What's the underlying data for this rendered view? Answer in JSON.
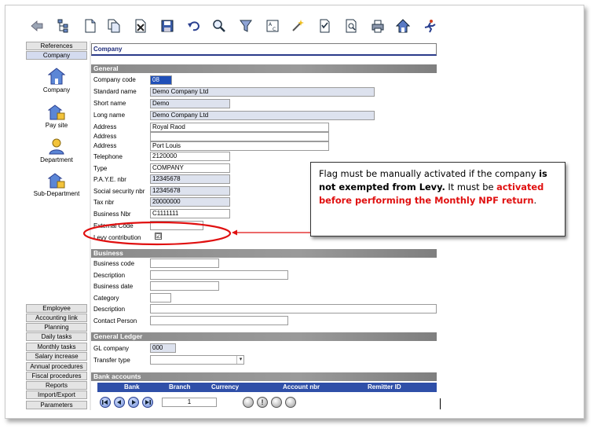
{
  "toolbar": {
    "icons": [
      "exit-icon",
      "tree-icon",
      "new-document-icon",
      "copy-document-icon",
      "delete-document-icon",
      "save-icon",
      "undo-icon",
      "search-icon",
      "filter-icon",
      "sort-icon",
      "wizard-icon",
      "checklist-icon",
      "report-preview-icon",
      "print-icon",
      "home-icon",
      "run-icon"
    ]
  },
  "nav": {
    "top_buttons": [
      "References",
      "Company"
    ],
    "side_items": [
      "Company",
      "Pay site",
      "Department",
      "Sub-Department"
    ],
    "bottom_buttons": [
      "Employee",
      "Accounting link",
      "Planning",
      "Daily tasks",
      "Monthly tasks",
      "Salary increase",
      "Annual procedures",
      "Fiscal procedures",
      "Reports",
      "Import/Export",
      "Parameters"
    ]
  },
  "form": {
    "title": "Company",
    "general": {
      "header": "General",
      "company_code_label": "Company code",
      "company_code": "08",
      "standard_name_label": "Standard name",
      "standard_name": "Demo Company Ltd",
      "short_name_label": "Short name",
      "short_name": "Demo",
      "long_name_label": "Long name",
      "long_name": "Demo Company Ltd",
      "address_label": "Address",
      "address1": "Royal Raod",
      "address2": "",
      "address3": "Port Louis",
      "telephone_label": "Telephone",
      "telephone": "2120000",
      "type_label": "Type",
      "type": "COMPANY",
      "paye_label": "P.A.Y.E. nbr",
      "paye": "12345678",
      "social_label": "Social security nbr",
      "social": "12345678",
      "tax_label": "Tax nbr",
      "tax": "20000000",
      "business_nbr_label": "Business Nbr",
      "business_nbr": "C1111111",
      "external_code_label": "External Code",
      "external_code": "",
      "levy_label": "Levy contribution",
      "levy_checked": "☑"
    },
    "business": {
      "header": "Business",
      "code_label": "Business code",
      "description_label": "Description",
      "date_label": "Business date",
      "category_label": "Category",
      "description2_label": "Description",
      "contact_label": "Contact Person"
    },
    "gl": {
      "header": "General Ledger",
      "gl_company_label": "GL company",
      "gl_company": "000",
      "transfer_type_label": "Transfer type"
    },
    "bank": {
      "header": "Bank accounts",
      "columns": [
        "Bank",
        "Branch",
        "Currency",
        "Account nbr",
        "Remitter ID"
      ]
    },
    "pager": {
      "page": "1"
    }
  },
  "callout": {
    "t1": "Flag must be manually activated if the company ",
    "t2": "is not exempted from Levy.",
    "t3": " It must be ",
    "t4": "activated before performing the Monthly NPF return",
    "t5": "."
  },
  "colors": {
    "accent": "#2f4fa8",
    "readonly_field": "#dde2ee",
    "annotation": "#e01010"
  }
}
